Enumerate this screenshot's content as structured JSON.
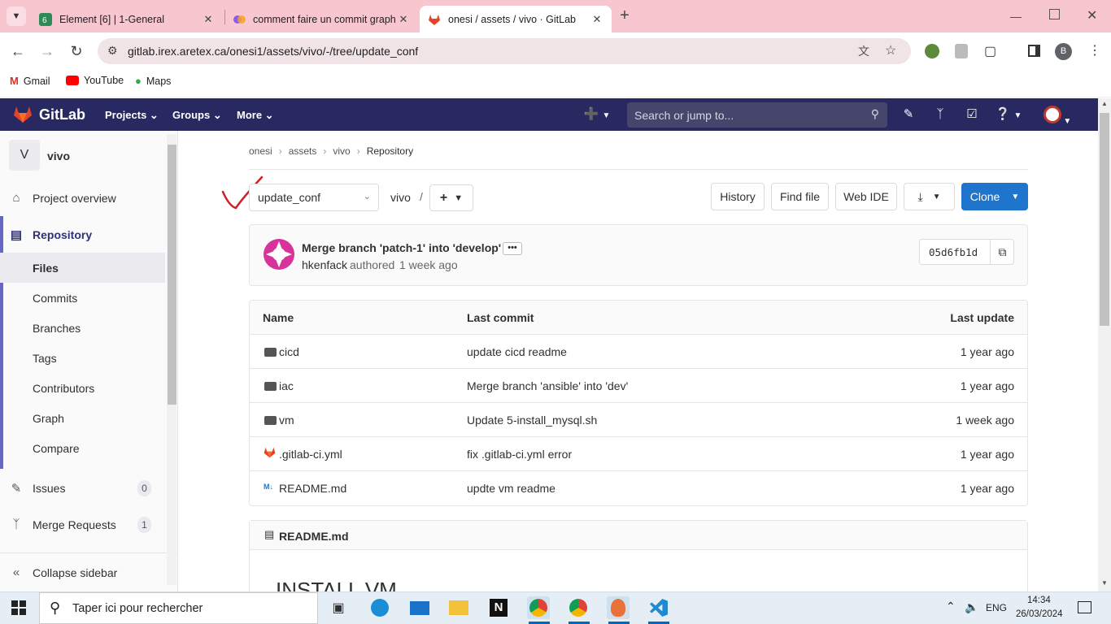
{
  "browser": {
    "tabs": [
      {
        "title": "Element [6] | 1-General",
        "icon": "element-icon"
      },
      {
        "title": "comment faire un commit graph",
        "icon": "copilot-icon"
      },
      {
        "title": "onesi / assets / vivo · GitLab",
        "icon": "gitlab-icon"
      }
    ],
    "url": "gitlab.irex.aretex.ca/onesi1/assets/vivo/-/tree/update_conf",
    "profile_initial": "B",
    "bookmarks": [
      {
        "label": "Gmail"
      },
      {
        "label": "YouTube"
      },
      {
        "label": "Maps"
      }
    ]
  },
  "gitlab": {
    "brand": "GitLab",
    "menus": [
      "Projects",
      "Groups",
      "More"
    ],
    "search_placeholder": "Search or jump to..."
  },
  "sidebar": {
    "project_initial": "V",
    "project_name": "vivo",
    "overview": "Project overview",
    "repository": "Repository",
    "repo_items": [
      "Files",
      "Commits",
      "Branches",
      "Tags",
      "Contributors",
      "Graph",
      "Compare"
    ],
    "issues": {
      "label": "Issues",
      "count": "0"
    },
    "merge_requests": {
      "label": "Merge Requests",
      "count": "1"
    },
    "collapse": "Collapse sidebar"
  },
  "breadcrumb": [
    "onesi",
    "assets",
    "vivo",
    "Repository"
  ],
  "toolbar": {
    "branch": "update_conf",
    "path_root": "vivo",
    "path_sep": "/",
    "history": "History",
    "find_file": "Find file",
    "web_ide": "Web IDE",
    "clone": "Clone"
  },
  "commit": {
    "message": "Merge branch 'patch-1' into 'develop'",
    "author": "hkenfack",
    "authored": "authored",
    "time": "1 week ago",
    "sha": "05d6fb1d"
  },
  "files": {
    "headers": {
      "name": "Name",
      "last_commit": "Last commit",
      "last_update": "Last update"
    },
    "rows": [
      {
        "name": "cicd",
        "type": "folder",
        "commit": "update cicd readme",
        "updated": "1 year ago"
      },
      {
        "name": "iac",
        "type": "folder",
        "commit": "Merge branch 'ansible' into 'dev'",
        "updated": "1 year ago"
      },
      {
        "name": "vm",
        "type": "folder",
        "commit": "Update 5-install_mysql.sh",
        "updated": "1 week ago"
      },
      {
        "name": ".gitlab-ci.yml",
        "type": "gitlab",
        "commit": "fix .gitlab-ci.yml error",
        "updated": "1 year ago"
      },
      {
        "name": "README.md",
        "type": "markdown",
        "commit": "updte vm readme",
        "updated": "1 year ago"
      }
    ]
  },
  "readme": {
    "filename": "README.md",
    "heading": "INSTALL VM"
  },
  "taskbar": {
    "search_placeholder": "Taper ici pour rechercher",
    "lang": "ENG",
    "time": "14:34",
    "date": "26/03/2024"
  },
  "colors": {
    "gitlab_nav": "#292961",
    "clone_blue": "#1f75cb",
    "tab_strip": "#f8c6cf",
    "sidebar_accent": "#6666c4"
  }
}
